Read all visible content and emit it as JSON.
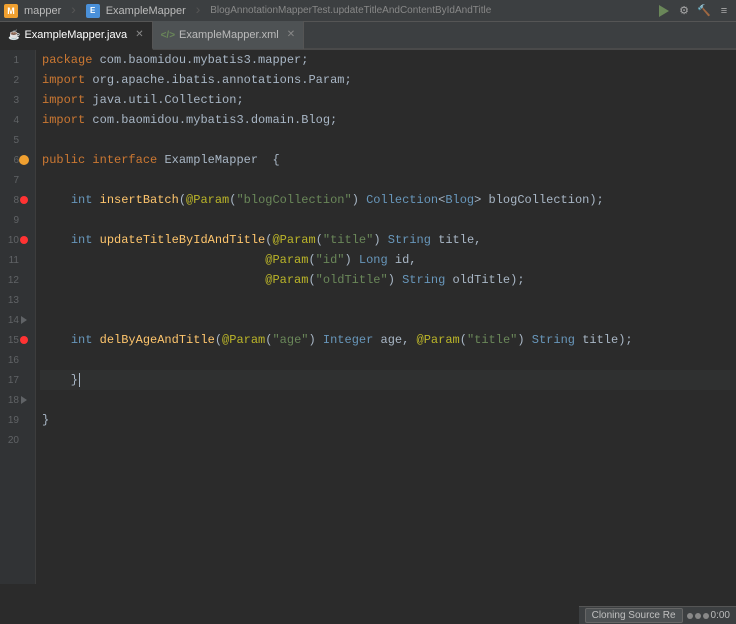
{
  "app": {
    "title": "mapper",
    "icon_label": "M"
  },
  "topbar": {
    "items": [
      {
        "label": "mapper",
        "icon": "M"
      },
      {
        "label": "ExampleMapper",
        "icon": "E"
      },
      {
        "label": "BlogAnnotationMapperTest.updateTitleAndContentByIdAndTitle",
        "icon": "test"
      }
    ],
    "run_label": "Run",
    "gear_label": "Settings",
    "build_label": "Build"
  },
  "tabs": [
    {
      "id": "java",
      "label": "ExampleMapper.java",
      "active": true,
      "type": "java"
    },
    {
      "id": "xml",
      "label": "ExampleMapper.xml",
      "active": false,
      "type": "xml"
    }
  ],
  "code": {
    "lines": [
      {
        "num": 1,
        "content": "package com.baomidou.mybatis3.mapper;",
        "has_fold": false,
        "has_bp": false,
        "has_run": false
      },
      {
        "num": 2,
        "content": "import org.apache.ibatis.annotations.Param;",
        "has_fold": false,
        "has_bp": false,
        "has_run": false
      },
      {
        "num": 3,
        "content": "import java.util.Collection;",
        "has_fold": false,
        "has_bp": false,
        "has_run": false
      },
      {
        "num": 4,
        "content": "import com.baomidou.mybatis3.domain.Blog;",
        "has_fold": false,
        "has_bp": false,
        "has_run": false
      },
      {
        "num": 5,
        "content": "",
        "has_fold": false,
        "has_bp": false,
        "has_run": false
      },
      {
        "num": 6,
        "content": "public interface ExampleMapper  {",
        "has_fold": true,
        "has_bp": false,
        "has_run": false,
        "bp_color": "#f0a030"
      },
      {
        "num": 7,
        "content": "",
        "has_fold": false,
        "has_bp": false,
        "has_run": false
      },
      {
        "num": 8,
        "content": "    int insertBatch(@Param(\"blogCollection\") Collection<Blog> blogCollection);",
        "has_fold": false,
        "has_bp": true,
        "has_run": true,
        "bp_color": "#ff3333"
      },
      {
        "num": 9,
        "content": "",
        "has_fold": false,
        "has_bp": false,
        "has_run": false
      },
      {
        "num": 10,
        "content": "    int updateTitleByIdAndTitle(@Param(\"title\") String title,",
        "has_fold": false,
        "has_bp": true,
        "has_run": true,
        "bp_color": "#ff3333"
      },
      {
        "num": 11,
        "content": "                               @Param(\"id\") Long id,",
        "has_fold": false,
        "has_bp": false,
        "has_run": false
      },
      {
        "num": 12,
        "content": "                               @Param(\"oldTitle\") String oldTitle);",
        "has_fold": false,
        "has_bp": false,
        "has_run": false
      },
      {
        "num": 13,
        "content": "",
        "has_fold": false,
        "has_bp": false,
        "has_run": false
      },
      {
        "num": 14,
        "content": "",
        "has_fold": false,
        "has_bp": false,
        "has_run": false,
        "has_fold_close": true
      },
      {
        "num": 15,
        "content": "    int delByAgeAndTitle(@Param(\"age\") Integer age, @Param(\"title\") String title);",
        "has_fold": false,
        "has_bp": true,
        "has_run": true,
        "bp_color": "#ff3333"
      },
      {
        "num": 16,
        "content": "",
        "has_fold": false,
        "has_bp": false,
        "has_run": false
      },
      {
        "num": 17,
        "content": "    }",
        "has_fold": false,
        "has_bp": false,
        "has_run": false,
        "is_current": true
      },
      {
        "num": 18,
        "content": "",
        "has_fold": false,
        "has_bp": false,
        "has_run": false,
        "has_fold_close": true
      },
      {
        "num": 19,
        "content": "}",
        "has_fold": false,
        "has_bp": false,
        "has_run": false
      },
      {
        "num": 20,
        "content": "",
        "has_fold": false,
        "has_bp": false,
        "has_run": false
      }
    ]
  },
  "status": {
    "cloning_text": "Cloning Source Re",
    "time_text": "0:00"
  }
}
